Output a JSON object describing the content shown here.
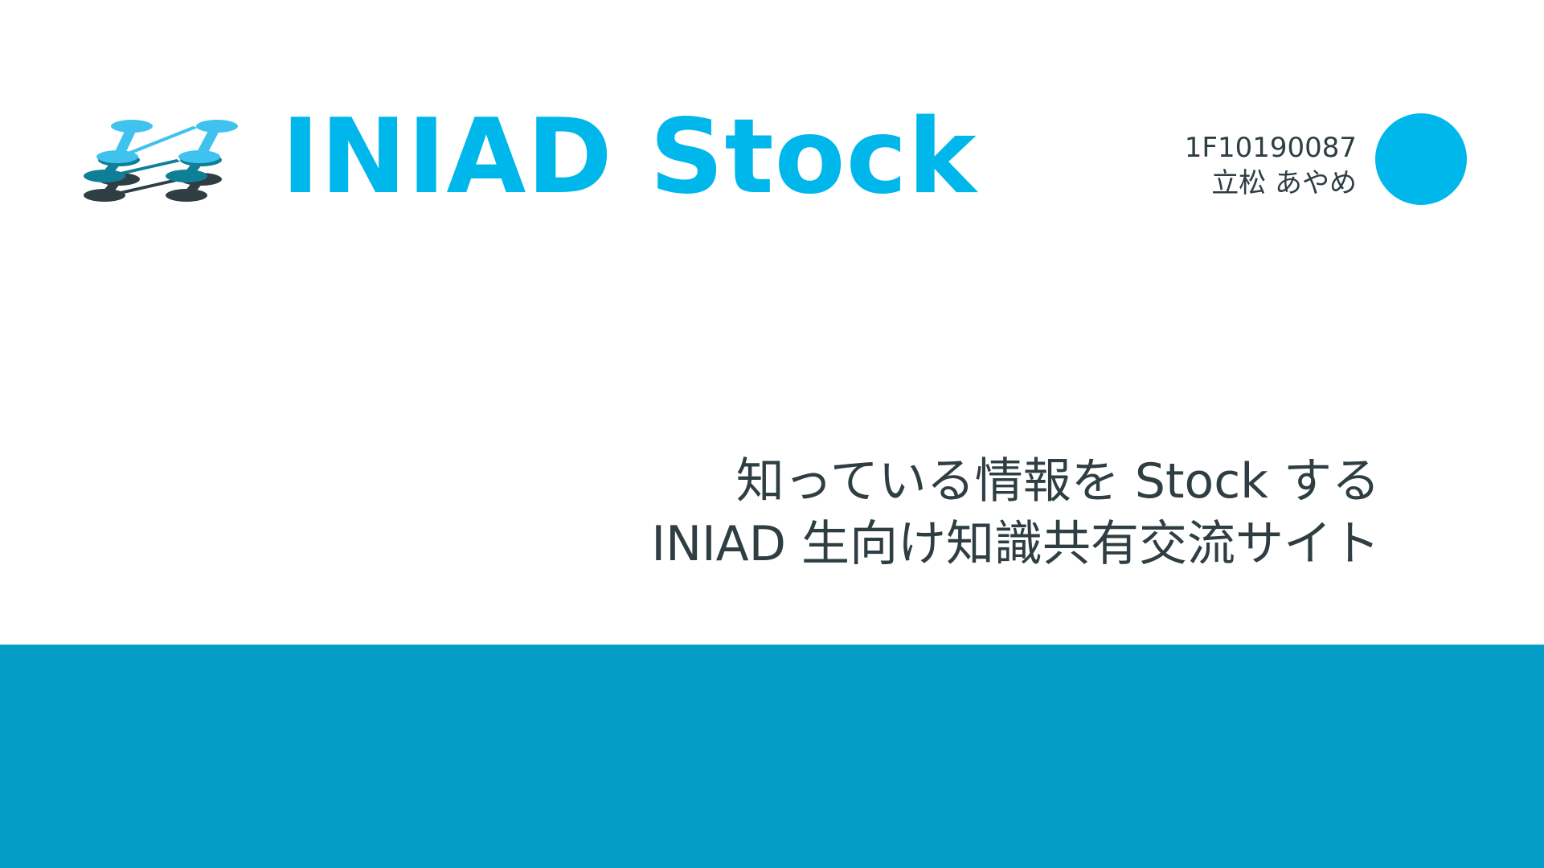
{
  "header": {
    "brand_title": "INIAD Stock",
    "logo_icon": "stacked-layers-icon"
  },
  "author": {
    "student_id": "1F10190087",
    "name": "立松 あやめ"
  },
  "tagline": {
    "line1": "知っている情報を Stock する",
    "line2": "INIAD 生向け知識共有交流サイト"
  },
  "colors": {
    "accent": "#00b7ec",
    "band": "#049dc6",
    "text_dark": "#2e3e42",
    "logo_mid": "#0f7f98",
    "logo_light": "#3fc3ee",
    "logo_dark": "#2f3e42"
  }
}
